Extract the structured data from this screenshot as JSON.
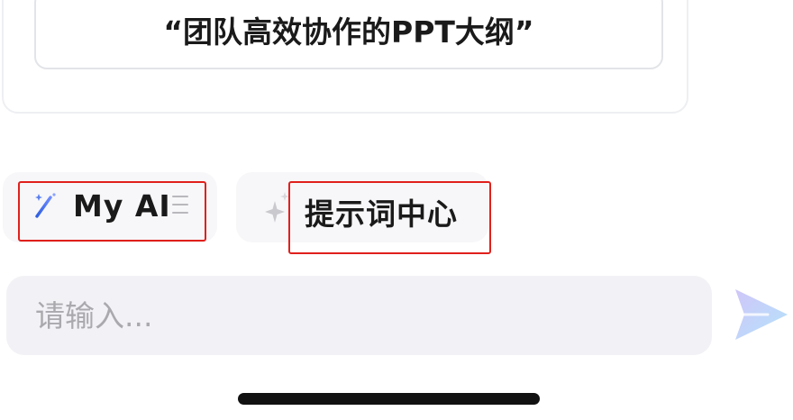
{
  "suggestion": {
    "prompt_text": "“团队高效协作的PPT大纲”"
  },
  "actions": {
    "my_ai_label": "My AI",
    "prompt_center_label": "提示词中心"
  },
  "input": {
    "placeholder": "请输入..."
  },
  "icons": {
    "my_ai": "magic-wand-icon",
    "menu": "menu-lines-icon",
    "prompt_center": "sparkle-icon",
    "send": "paper-plane-send-icon"
  },
  "colors": {
    "highlight": "#e0201c",
    "send_gradient_start": "#c8c3f7",
    "send_gradient_end": "#b9e4fb",
    "wand": "#3b5bd6"
  }
}
